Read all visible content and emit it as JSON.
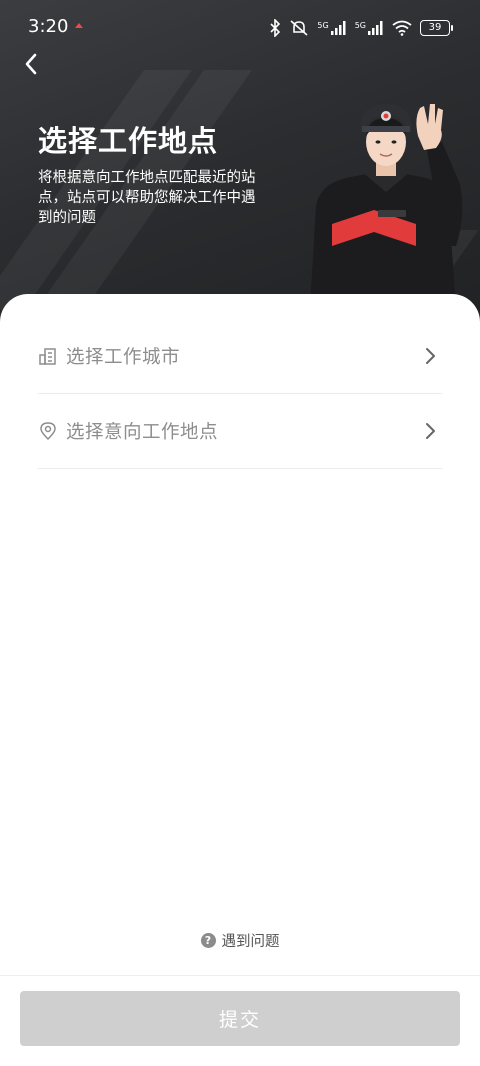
{
  "status_bar": {
    "time": "3:20",
    "battery": "39",
    "network_1": "5G",
    "network_2": "5G"
  },
  "header": {
    "title": "选择工作地点",
    "subtitle": "将根据意向工作地点匹配最近的站点，站点可以帮助您解决工作中遇到的问题"
  },
  "form": {
    "city_placeholder": "选择工作城市",
    "location_placeholder": "选择意向工作地点"
  },
  "help": {
    "icon_glyph": "?",
    "label": "遇到问题"
  },
  "footer": {
    "submit_label": "提交"
  },
  "colors": {
    "header_bg": "#2b2d30",
    "accent_red": "#e23b3b",
    "button_disabled": "#cfcfcf"
  },
  "icons": [
    "bluetooth-icon",
    "mute-icon",
    "signal-icon",
    "wifi-icon",
    "back-icon",
    "building-icon",
    "location-pin-icon",
    "chevron-right-icon",
    "help-icon"
  ]
}
